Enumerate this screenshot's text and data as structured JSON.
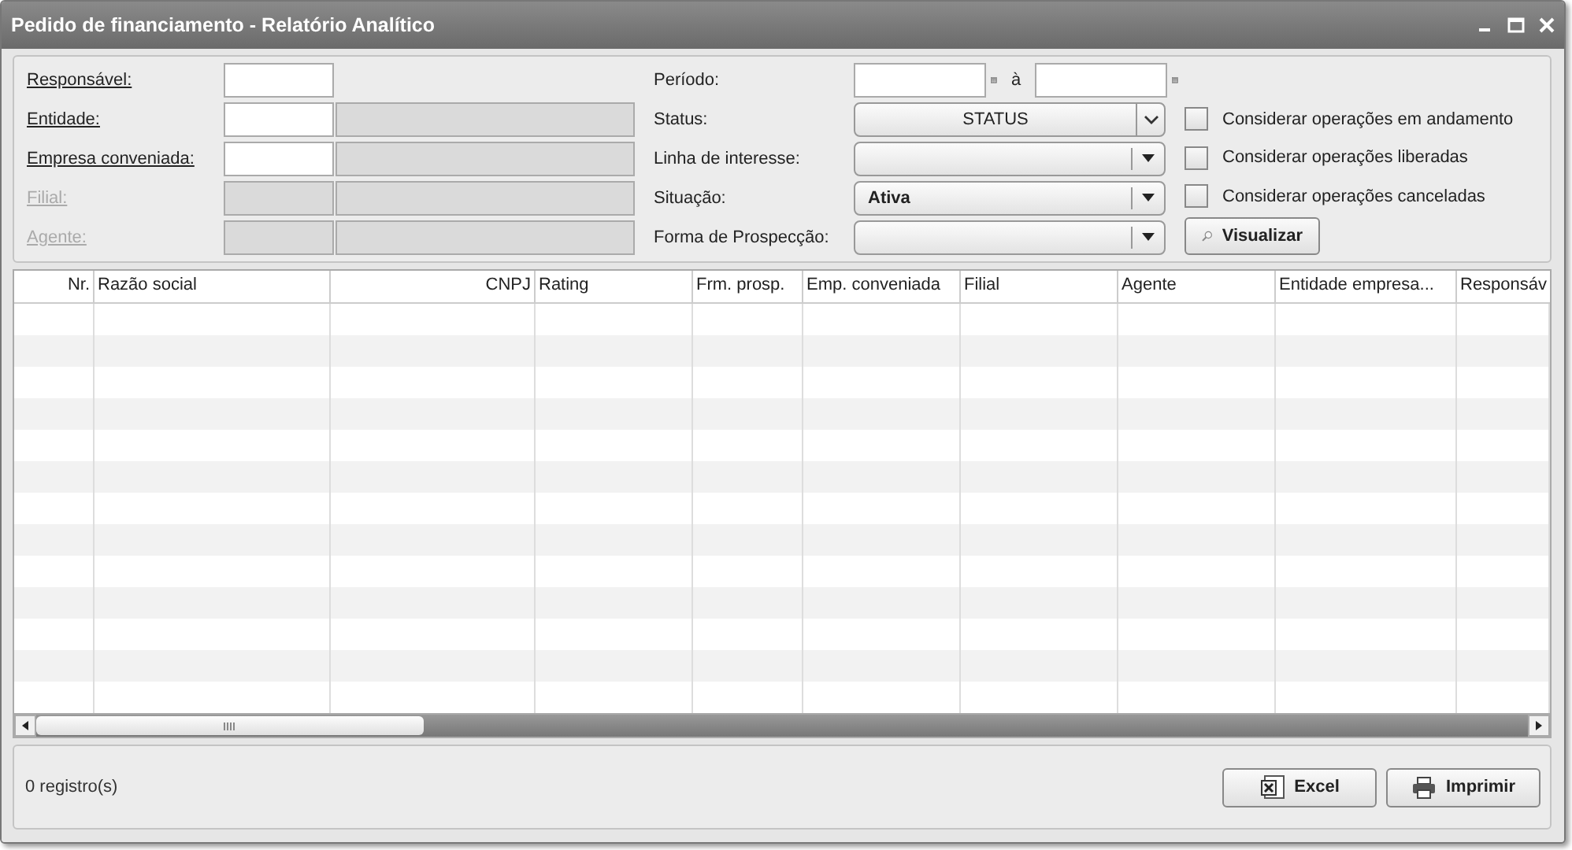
{
  "window": {
    "title": "Pedido de financiamento - Relatório Analítico"
  },
  "filters_left": [
    {
      "label": "Responsável:",
      "disabled": false,
      "fields": [
        {
          "kind": "code"
        }
      ]
    },
    {
      "label": "Entidade:",
      "disabled": false,
      "fields": [
        {
          "kind": "code"
        },
        {
          "kind": "description"
        }
      ]
    },
    {
      "label": "Empresa conveniada:",
      "disabled": false,
      "fields": [
        {
          "kind": "code"
        },
        {
          "kind": "description"
        }
      ]
    },
    {
      "label": "Filial:",
      "disabled": true,
      "fields": [
        {
          "kind": "code"
        },
        {
          "kind": "description"
        }
      ]
    },
    {
      "label": "Agente:",
      "disabled": true,
      "fields": [
        {
          "kind": "code"
        },
        {
          "kind": "description"
        }
      ]
    }
  ],
  "period": {
    "label": "Período:",
    "separator": "à"
  },
  "selects": [
    {
      "label": "Status:",
      "value": "STATUS",
      "kind": "multi"
    },
    {
      "label": "Linha de interesse:",
      "kind": "single"
    },
    {
      "label": "Situação:",
      "value": "Ativa",
      "kind": "single"
    },
    {
      "label": "Forma de Prospecção:",
      "kind": "single"
    }
  ],
  "checkboxes": [
    {
      "label": "Considerar operações em andamento",
      "checked": false
    },
    {
      "label": "Considerar operações liberadas",
      "checked": false
    },
    {
      "label": "Considerar operações canceladas",
      "checked": false
    }
  ],
  "view_button": "Visualizar",
  "table": {
    "columns": [
      {
        "label": "Nr.",
        "kind": "numeric"
      },
      {
        "label": "Razão social",
        "kind": "text"
      },
      {
        "label": "CNPJ",
        "kind": "numeric"
      },
      {
        "label": "Rating",
        "kind": "text"
      },
      {
        "label": "Frm. prosp.",
        "kind": "text"
      },
      {
        "label": "Emp. conveniada",
        "kind": "text"
      },
      {
        "label": "Filial",
        "kind": "text"
      },
      {
        "label": "Agente",
        "kind": "text"
      },
      {
        "label": "Entidade empresa...",
        "kind": "text"
      },
      {
        "label": "Responsáv",
        "kind": "text"
      }
    ]
  },
  "status_bar": {
    "count": "0 registro(s)",
    "buttons": [
      {
        "label": "Excel",
        "kind": "excel"
      },
      {
        "label": "Imprimir",
        "kind": "print"
      }
    ]
  }
}
